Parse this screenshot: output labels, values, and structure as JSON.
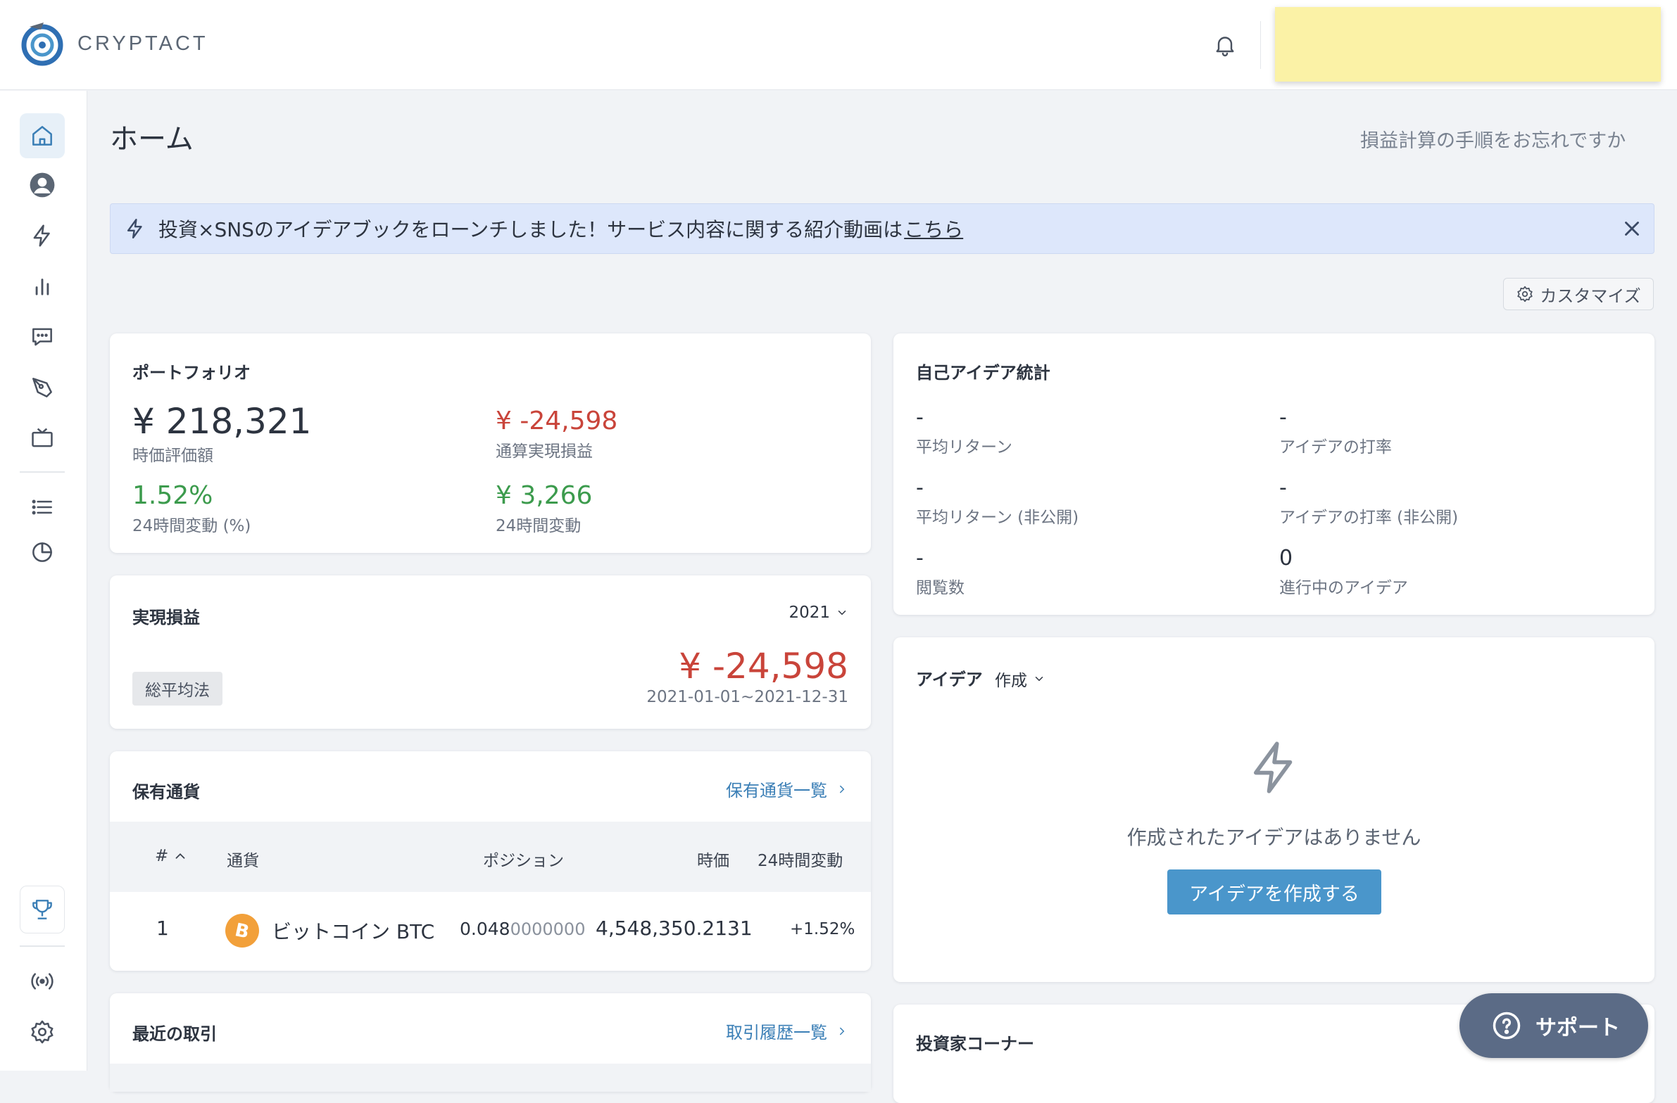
{
  "brand": {
    "name": "CRYPTACT"
  },
  "colors": {
    "accent": "#4a96cb",
    "negative": "#c9443a",
    "positive": "#3c9b4d",
    "banner_bg": "#dde7fb",
    "user_box": "#fbf2a6"
  },
  "sidebar": {
    "items": [
      {
        "icon": "home-icon",
        "active": true
      },
      {
        "icon": "user-avatar-icon"
      },
      {
        "icon": "lightning-icon"
      },
      {
        "icon": "bar-chart-icon"
      },
      {
        "icon": "chat-icon"
      },
      {
        "icon": "pen-nib-icon"
      },
      {
        "icon": "tv-icon"
      },
      {
        "icon": "list-icon"
      },
      {
        "icon": "pie-chart-icon"
      },
      {
        "icon": "trophy-icon"
      },
      {
        "icon": "broadcast-icon"
      },
      {
        "icon": "settings-gear-icon"
      }
    ]
  },
  "page": {
    "title": "ホーム",
    "help_link": "損益計算の手順をお忘れですか"
  },
  "banner": {
    "text": "投資×SNSのアイデアブックをローンチしました！サービス内容に関する紹介動画は",
    "link": "こちら"
  },
  "customize": {
    "label": "カスタマイズ"
  },
  "portfolio": {
    "title": "ポートフォリオ",
    "market_value": "¥ 218,321",
    "market_value_label": "時価評価額",
    "realized_total": "¥ -24,598",
    "realized_total_label": "通算実現損益",
    "change_pct": "1.52%",
    "change_pct_label": "24時間変動 (%)",
    "change_amt": "¥ 3,266",
    "change_amt_label": "24時間変動"
  },
  "realized": {
    "title": "実現損益",
    "year": "2021",
    "method": "総平均法",
    "amount": "¥ -24,598",
    "period": "2021-01-01~2021-12-31"
  },
  "holdings": {
    "title": "保有通貨",
    "link": "保有通貨一覧",
    "columns": {
      "index": "#",
      "currency": "通貨",
      "position": "ポジション",
      "price": "時価",
      "change": "24時間変動"
    },
    "rows": [
      {
        "index": "1",
        "name": "ビットコイン BTC",
        "position_main": "0.048",
        "position_rest": "0000000",
        "price": "4,548,350.2131",
        "change": "+1.52%"
      }
    ]
  },
  "recent": {
    "title": "最近の取引",
    "link": "取引履歴一覧"
  },
  "idea_stats": {
    "title": "自己アイデア統計",
    "items": [
      {
        "value": "-",
        "label": "平均リターン"
      },
      {
        "value": "-",
        "label": "アイデアの打率"
      },
      {
        "value": "-",
        "label": "平均リターン (非公開)"
      },
      {
        "value": "-",
        "label": "アイデアの打率 (非公開)"
      },
      {
        "value": "-",
        "label": "閲覧数"
      },
      {
        "value": "0",
        "label": "進行中のアイデア"
      }
    ]
  },
  "ideas": {
    "title": "アイデア",
    "filter": "作成",
    "empty_message": "作成されたアイデアはありません",
    "create_button": "アイデアを作成する"
  },
  "investor_corner": {
    "title": "投資家コーナー"
  },
  "support": {
    "label": "サポート"
  }
}
